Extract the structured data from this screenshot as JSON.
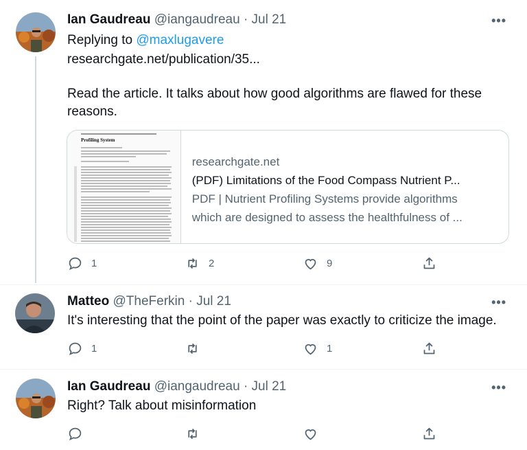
{
  "tweets": [
    {
      "name": "Ian Gaudreau",
      "handle": "@iangaudreau",
      "dot": "·",
      "date": "Jul 21",
      "more": "•••",
      "reply_prefix": "Replying to",
      "reply_to": "@maxlugavere",
      "link": "researchgate.net/publication/35...",
      "text": "Read the article. It talks about how good algorithms are flawed for these reasons.",
      "card": {
        "domain": "researchgate.net",
        "title": "(PDF) Limitations of the Food Compass Nutrient P...",
        "description_line1": "PDF | Nutrient Profiling Systems provide algorithms",
        "description_line2": "which are designed to assess the healthfulness of ...",
        "thumb_title": "Profiling System"
      },
      "counts": {
        "replies": "1",
        "retweets": "2",
        "likes": "9"
      }
    },
    {
      "name": "Matteo",
      "handle": "@TheFerkin",
      "dot": "·",
      "date": "Jul 21",
      "more": "•••",
      "text": "It's interesting that the point of the paper was exactly to criticize the image.",
      "counts": {
        "replies": "1",
        "retweets": "",
        "likes": "1"
      }
    },
    {
      "name": "Ian Gaudreau",
      "handle": "@iangaudreau",
      "dot": "·",
      "date": "Jul 21",
      "more": "•••",
      "text": "Right? Talk about misinformation",
      "counts": {
        "replies": "",
        "retweets": "",
        "likes": ""
      }
    }
  ],
  "colors": {
    "accent": "#1d9bf0",
    "secondary": "#536471",
    "border": "#cfd9de"
  },
  "icons": [
    "reply-icon",
    "retweet-icon",
    "like-icon",
    "share-icon",
    "more-icon"
  ]
}
